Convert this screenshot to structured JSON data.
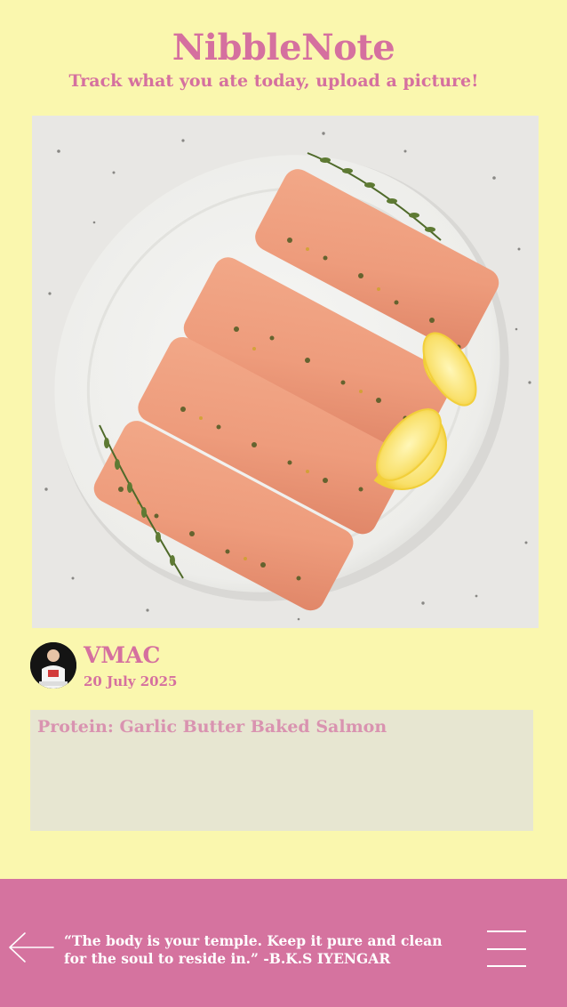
{
  "app": {
    "title": "NibbleNote",
    "subtitle": "Track what you ate today, upload a picture!"
  },
  "post": {
    "image_alt": "Garlic butter baked salmon fillets on a white oval platter with lemon wedges and thyme",
    "user": {
      "name": "VMAC",
      "avatar_icon": "user-avatar"
    },
    "date": "20 July 2025",
    "note": "Protein: Garlic Butter Baked Salmon"
  },
  "footer": {
    "quote": "“The body is your temple. Keep it pure and clean for the soul to reside in.” -B.K.S IYENGAR",
    "back_icon": "arrow-left-icon",
    "menu_icon": "hamburger-menu-icon"
  },
  "colors": {
    "background": "#FAF7AE",
    "accent": "#D5709F",
    "footer": "#D5739F",
    "note_box": "#E7E6D1"
  }
}
